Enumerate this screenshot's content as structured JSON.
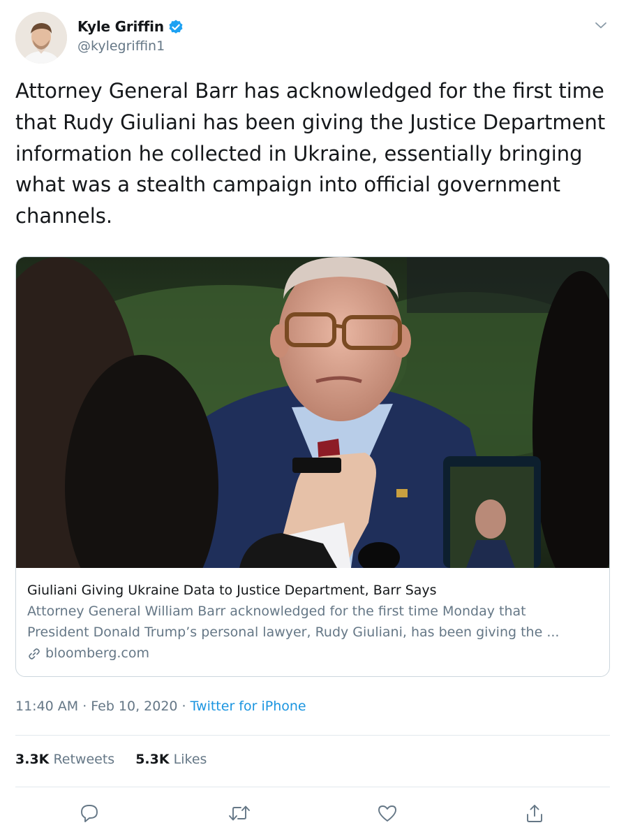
{
  "author": {
    "display_name": "Kyle Griffin",
    "handle": "@kylegriffin1",
    "verified": true
  },
  "tweet": {
    "text": "Attorney General Barr has acknowledged for the first time that Rudy Giuliani has been giving the Justice Department information he collected in Ukraine, essentially bringing what was a stealth campaign into official government channels."
  },
  "card": {
    "title": "Giuliani Giving Ukraine Data to Justice Department, Barr Says",
    "description": "Attorney General William Barr acknowledged for the first time Monday that President Donald Trump’s personal lawyer, Rudy Giuliani, has been giving the ...",
    "domain": "bloomberg.com"
  },
  "meta": {
    "time": "11:40 AM",
    "date": "Feb 10, 2020",
    "separator": "·",
    "source": "Twitter for iPhone"
  },
  "stats": {
    "retweets_count": "3.3K",
    "retweets_label": "Retweets",
    "likes_count": "5.3K",
    "likes_label": "Likes"
  },
  "icons": {
    "verified": "verified-badge-icon",
    "caret": "chevron-down-icon",
    "link": "link-icon",
    "reply": "reply-icon",
    "retweet": "retweet-icon",
    "like": "heart-icon",
    "share": "share-icon"
  },
  "colors": {
    "accent": "#1da1f2",
    "link": "#1b95e0",
    "secondary_text": "#657786",
    "border": "#ccd6dd"
  }
}
